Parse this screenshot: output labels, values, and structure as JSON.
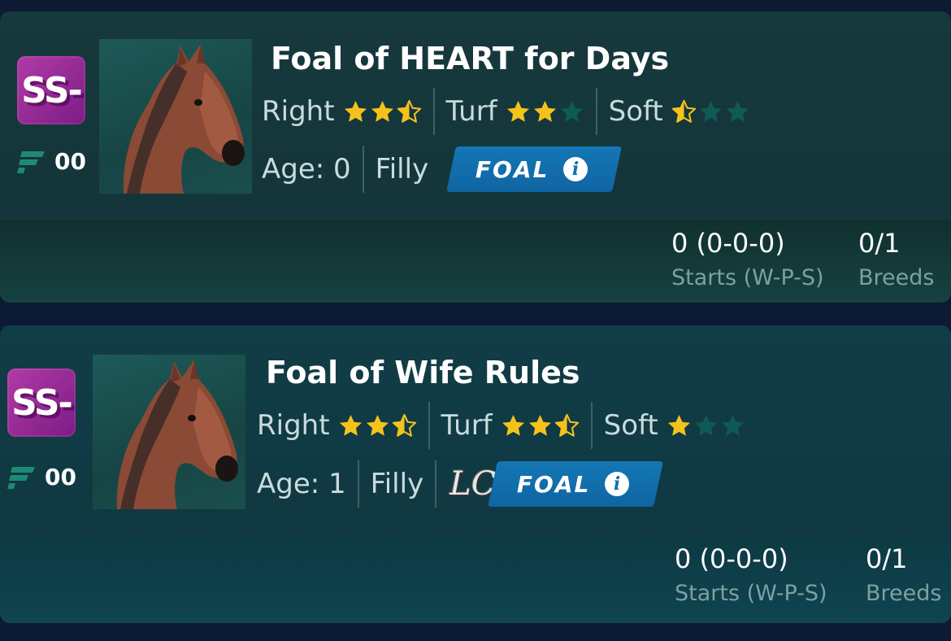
{
  "cards": [
    {
      "grade": "SS-",
      "stable_number": "00",
      "name": "Foal of HEART for Days",
      "prefs": [
        {
          "label": "Right",
          "rating": 2.5
        },
        {
          "label": "Turf",
          "rating": 2
        },
        {
          "label": "Soft",
          "rating": 0.5
        }
      ],
      "age": "Age: 0",
      "sex": "Filly",
      "has_lc_logo": false,
      "badge_label": "FOAL",
      "info_icon_glyph": "i",
      "starts_value": "0 (0-0-0)",
      "starts_label": "Starts (W-P-S)",
      "breeds_value": "0/1",
      "breeds_label": "Breeds"
    },
    {
      "grade": "SS-",
      "stable_number": "00",
      "name": "Foal of Wife Rules",
      "prefs": [
        {
          "label": "Right",
          "rating": 2.5
        },
        {
          "label": "Turf",
          "rating": 2.5
        },
        {
          "label": "Soft",
          "rating": 1
        }
      ],
      "age": "Age: 1",
      "sex": "Filly",
      "has_lc_logo": true,
      "lc_logo": "LC",
      "badge_label": "FOAL",
      "info_icon_glyph": "i",
      "starts_value": "0 (0-0-0)",
      "starts_label": "Starts (W-P-S)",
      "breeds_value": "0/1",
      "breeds_label": "Breeds"
    }
  ],
  "colors": {
    "page_bg": "#0c1a33",
    "grade_badge": "#9b2c98",
    "star_filled": "#f5c21b",
    "star_empty": "#0f5a57",
    "foal_badge": "#1372b0"
  },
  "icons": [
    "stable-flag-icon",
    "horse-portrait",
    "star-icon",
    "info-icon"
  ]
}
